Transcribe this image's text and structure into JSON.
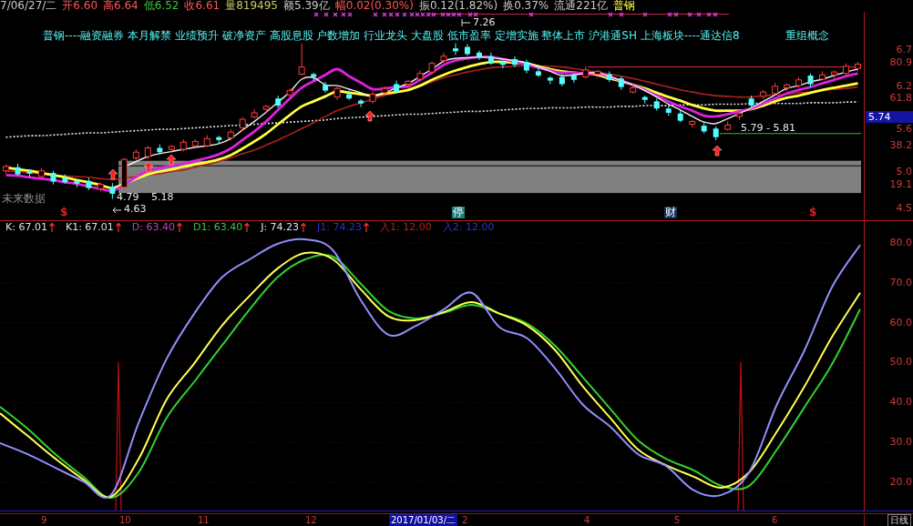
{
  "quote_bar": {
    "items": [
      {
        "text": "7/06/27/二",
        "color": "#c8c8c8"
      },
      {
        "text": "开6.60",
        "color": "#ff5454"
      },
      {
        "text": "高6.64",
        "color": "#ff5454"
      },
      {
        "text": "低6.52",
        "color": "#3cc83c"
      },
      {
        "text": "收6.61",
        "color": "#ff5454"
      },
      {
        "text": "量819495",
        "color": "#c8c864"
      },
      {
        "text": "额5.39亿",
        "color": "#c8c8c8"
      },
      {
        "text": "幅0.02(0.30%)",
        "color": "#ff5454"
      },
      {
        "text": "振0.12(1.82%)",
        "color": "#c8c8c8"
      },
      {
        "text": "换0.37%",
        "color": "#c8c8c8"
      },
      {
        "text": "流通221亿",
        "color": "#c8c8c8"
      },
      {
        "text": "普钢",
        "color": "#ffff40"
      }
    ]
  },
  "price_panel": {
    "concepts": "普钢----融资融券 本月解禁 业绩预升 破净资产 高股息股 户数增加 行业龙头 大盘股 低市盈率 定增实施 整体上市 沪港通SH 上海板块----通达信8",
    "concepts_tail": "重组概念",
    "future_label": "未来数据",
    "annotations": [
      "7.26",
      "5.79 - 5.81",
      "4.79",
      "5.18",
      "4.63"
    ],
    "markers": [
      {
        "text": "$",
        "kind": "plain",
        "color": "#e02020"
      },
      {
        "text": "停",
        "kind": "boxed",
        "color": "#1e7e7e"
      },
      {
        "text": "财",
        "kind": "boxed",
        "color": "#12305a"
      },
      {
        "text": "$",
        "kind": "plain",
        "color": "#e02020"
      }
    ],
    "level_labels": [
      "80.9",
      "61.8",
      "38.2",
      "19.1"
    ],
    "current_price": "5.74",
    "chart_data": {
      "type": "candlestick",
      "ylim": [
        4.33,
        7.24
      ],
      "yticks": [
        {
          "value": 6.7,
          "label": "6.7"
        },
        {
          "value": 6.2,
          "label": "6.2"
        },
        {
          "value": 5.6,
          "label": "5.6"
        },
        {
          "value": 5.0,
          "label": "5.0"
        },
        {
          "value": 4.5,
          "label": "4.5"
        }
      ],
      "categories": [
        null,
        null,
        null,
        null,
        null,
        null,
        null,
        null,
        null,
        null,
        null,
        null,
        null,
        null,
        null,
        null,
        null,
        null,
        null,
        null,
        null,
        null,
        null,
        null,
        null,
        null,
        null,
        null,
        null,
        null,
        null,
        null,
        null,
        null,
        null,
        null,
        null,
        null,
        null,
        null,
        null,
        null,
        null,
        null,
        null,
        null,
        null,
        null,
        null,
        null,
        null,
        null,
        null,
        null,
        null,
        null,
        null,
        null,
        null,
        null,
        null,
        null,
        null,
        null,
        null,
        null,
        null,
        null,
        null,
        null,
        null,
        null,
        null
      ],
      "ohlc": [
        [
          5.02,
          5.11,
          4.98,
          5.08
        ],
        [
          5.07,
          5.12,
          4.95,
          4.97
        ],
        [
          5.02,
          5.04,
          4.93,
          4.98
        ],
        [
          4.94,
          5.06,
          4.91,
          5.02
        ],
        [
          4.99,
          5.02,
          4.83,
          4.87
        ],
        [
          4.92,
          4.97,
          4.84,
          4.86
        ],
        [
          4.88,
          4.9,
          4.79,
          4.84
        ],
        [
          4.88,
          4.92,
          4.75,
          4.78
        ],
        [
          4.77,
          4.86,
          4.73,
          4.83
        ],
        [
          4.8,
          4.85,
          4.63,
          4.7
        ],
        [
          4.79,
          5.2,
          4.78,
          5.18
        ],
        [
          5.2,
          5.32,
          5.17,
          5.28
        ],
        [
          5.22,
          5.37,
          5.18,
          5.34
        ],
        [
          5.34,
          5.39,
          5.26,
          5.28
        ],
        [
          5.32,
          5.38,
          5.27,
          5.36
        ],
        [
          5.32,
          5.46,
          5.29,
          5.42
        ],
        [
          5.37,
          5.46,
          5.33,
          5.43
        ],
        [
          5.37,
          5.52,
          5.35,
          5.47
        ],
        [
          5.49,
          5.51,
          5.4,
          5.45
        ],
        [
          5.48,
          5.6,
          5.45,
          5.56
        ],
        [
          5.62,
          5.77,
          5.58,
          5.74
        ],
        [
          5.77,
          5.88,
          5.75,
          5.83
        ],
        [
          5.88,
          5.94,
          5.83,
          5.92
        ],
        [
          6.03,
          6.07,
          5.9,
          5.93
        ],
        [
          6.08,
          6.17,
          6.04,
          6.14
        ],
        [
          6.37,
          6.8,
          6.35,
          6.47
        ],
        [
          6.37,
          6.39,
          6.28,
          6.33
        ],
        [
          6.22,
          6.26,
          6.11,
          6.14
        ],
        [
          6.05,
          6.2,
          6.01,
          6.17
        ],
        [
          6.09,
          6.14,
          6.01,
          6.03
        ],
        [
          6.0,
          6.02,
          5.91,
          5.96
        ],
        [
          5.99,
          6.13,
          5.96,
          6.09
        ],
        [
          6.11,
          6.2,
          6.07,
          6.17
        ],
        [
          6.23,
          6.28,
          6.11,
          6.13
        ],
        [
          6.23,
          6.29,
          6.18,
          6.27
        ],
        [
          6.3,
          6.42,
          6.27,
          6.38
        ],
        [
          6.4,
          6.55,
          6.36,
          6.52
        ],
        [
          6.56,
          6.67,
          6.54,
          6.62
        ],
        [
          6.73,
          6.8,
          6.64,
          6.69
        ],
        [
          6.75,
          6.79,
          6.62,
          6.65
        ],
        [
          6.67,
          6.7,
          6.57,
          6.61
        ],
        [
          6.62,
          6.67,
          6.5,
          6.52
        ],
        [
          6.54,
          6.56,
          6.45,
          6.5
        ],
        [
          6.58,
          6.62,
          6.47,
          6.5
        ],
        [
          6.54,
          6.57,
          6.38,
          6.42
        ],
        [
          6.41,
          6.46,
          6.33,
          6.35
        ],
        [
          6.32,
          6.34,
          6.23,
          6.28
        ],
        [
          6.33,
          6.37,
          6.2,
          6.23
        ],
        [
          6.35,
          6.38,
          6.25,
          6.29
        ],
        [
          6.33,
          6.48,
          6.31,
          6.43
        ],
        [
          6.37,
          6.43,
          6.32,
          6.41
        ],
        [
          6.37,
          6.41,
          6.26,
          6.29
        ],
        [
          6.31,
          6.34,
          6.15,
          6.19
        ],
        [
          6.12,
          6.23,
          6.1,
          6.18
        ],
        [
          6.05,
          6.07,
          5.96,
          6.01
        ],
        [
          5.99,
          6.03,
          5.86,
          5.89
        ],
        [
          5.89,
          5.92,
          5.79,
          5.83
        ],
        [
          5.82,
          5.87,
          5.7,
          5.72
        ],
        [
          5.67,
          5.73,
          5.62,
          5.71
        ],
        [
          5.65,
          5.69,
          5.54,
          5.57
        ],
        [
          5.61,
          5.64,
          5.45,
          5.49
        ],
        [
          5.6,
          5.71,
          5.58,
          5.66
        ],
        [
          5.78,
          5.84,
          5.73,
          5.82
        ],
        [
          6.03,
          6.07,
          5.9,
          5.93
        ],
        [
          6.06,
          6.15,
          6.02,
          6.12
        ],
        [
          6.1,
          6.25,
          6.08,
          6.2
        ],
        [
          6.18,
          6.24,
          6.13,
          6.22
        ],
        [
          6.21,
          6.33,
          6.18,
          6.29
        ],
        [
          6.35,
          6.38,
          6.19,
          6.23
        ],
        [
          6.3,
          6.41,
          6.28,
          6.36
        ],
        [
          6.36,
          6.42,
          6.31,
          6.4
        ],
        [
          6.38,
          6.52,
          6.35,
          6.48
        ],
        [
          6.45,
          6.54,
          6.41,
          6.51
        ]
      ],
      "series": [
        {
          "type": "line",
          "color": "#e8e8e8",
          "line_style": "dashed",
          "values": [
            5.49,
            5.5,
            5.51,
            5.51,
            5.52,
            5.53,
            5.54,
            5.55,
            5.55,
            5.56,
            5.57,
            5.58,
            5.59,
            5.6,
            5.6,
            5.61,
            5.62,
            5.63,
            5.64,
            5.65,
            5.66,
            5.67,
            5.68,
            5.69,
            5.7,
            5.71,
            5.72,
            5.73,
            5.75,
            5.76,
            5.77,
            5.78,
            5.79,
            5.8,
            5.81,
            5.81,
            5.82,
            5.83,
            5.84,
            5.85,
            5.85,
            5.86,
            5.87,
            5.88,
            5.89,
            5.89,
            5.9,
            5.9,
            5.9,
            5.91,
            5.91,
            5.91,
            5.92,
            5.92,
            5.93,
            5.93,
            5.93,
            5.94,
            5.94,
            5.94,
            5.95,
            5.95,
            5.95,
            5.96,
            5.96,
            5.96,
            5.96,
            5.96,
            5.97,
            5.97,
            5.97,
            5.98,
            5.98
          ]
        },
        {
          "type": "line",
          "color": "#b02020",
          "values": [
            5.02,
            5.01,
            4.99,
            4.98,
            4.96,
            4.95,
            4.94,
            4.93,
            4.91,
            4.9,
            4.92,
            4.94,
            4.96,
            4.98,
            5.01,
            5.03,
            5.07,
            5.11,
            5.15,
            5.2,
            5.26,
            5.31,
            5.38,
            5.45,
            5.53,
            5.61,
            5.69,
            5.78,
            5.86,
            5.92,
            5.97,
            6.02,
            6.07,
            6.11,
            6.15,
            6.2,
            6.26,
            6.32,
            6.36,
            6.4,
            6.43,
            6.46,
            6.47,
            6.48,
            6.49,
            6.48,
            6.48,
            6.47,
            6.45,
            6.42,
            6.4,
            6.37,
            6.34,
            6.31,
            6.27,
            6.23,
            6.19,
            6.15,
            6.12,
            6.09,
            6.07,
            6.06,
            6.05,
            6.05,
            6.07,
            6.08,
            6.09,
            6.11,
            6.12,
            6.14,
            6.16,
            6.17,
            6.19
          ]
        },
        {
          "type": "line",
          "color": "#ffff40",
          "values": [
            5.07,
            5.04,
            5.02,
            4.99,
            4.96,
            4.93,
            4.89,
            4.86,
            4.82,
            4.78,
            4.84,
            4.91,
            4.97,
            5.01,
            5.04,
            5.08,
            5.11,
            5.14,
            5.18,
            5.24,
            5.33,
            5.43,
            5.54,
            5.67,
            5.8,
            5.92,
            5.99,
            6.06,
            6.13,
            6.11,
            6.09,
            6.07,
            6.1,
            6.12,
            6.15,
            6.21,
            6.29,
            6.36,
            6.42,
            6.47,
            6.51,
            6.54,
            6.54,
            6.53,
            6.52,
            6.48,
            6.44,
            6.41,
            6.39,
            6.38,
            6.36,
            6.31,
            6.27,
            6.22,
            6.17,
            6.11,
            6.05,
            6.0,
            5.94,
            5.89,
            5.86,
            5.86,
            5.86,
            5.88,
            5.93,
            5.99,
            6.04,
            6.07,
            6.11,
            6.15,
            6.18,
            6.21,
            6.24
          ]
        },
        {
          "type": "line",
          "color": "#e020e0",
          "values": [
            4.96,
            4.95,
            4.93,
            4.91,
            4.89,
            4.86,
            4.84,
            4.8,
            4.77,
            4.74,
            4.83,
            4.93,
            5.02,
            5.06,
            5.09,
            5.12,
            5.16,
            5.2,
            5.25,
            5.33,
            5.45,
            5.57,
            5.71,
            5.87,
            6.03,
            6.18,
            6.27,
            6.36,
            6.44,
            6.34,
            6.25,
            6.16,
            6.17,
            6.19,
            6.2,
            6.29,
            6.39,
            6.5,
            6.56,
            6.59,
            6.61,
            6.61,
            6.58,
            6.54,
            6.5,
            6.46,
            6.42,
            6.39,
            6.39,
            6.38,
            6.38,
            6.33,
            6.28,
            6.22,
            6.15,
            6.07,
            5.99,
            5.92,
            5.86,
            5.79,
            5.78,
            5.81,
            5.85,
            5.89,
            5.96,
            6.03,
            6.1,
            6.15,
            6.19,
            6.24,
            6.29,
            6.34,
            6.38
          ]
        },
        {
          "type": "line",
          "color": "#f0f0f0",
          "values": [
            null,
            null,
            null,
            null,
            null,
            null,
            null,
            null,
            null,
            null,
            5.07,
            5.15,
            5.22,
            5.26,
            5.29,
            5.32,
            5.35,
            5.37,
            5.4,
            5.47,
            5.59,
            5.71,
            5.84,
            5.98,
            6.12,
            6.3,
            6.32,
            6.22,
            6.21,
            6.16,
            6.11,
            6.06,
            6.11,
            6.18,
            6.24,
            6.34,
            6.44,
            6.55,
            6.59,
            6.6,
            6.61,
            6.6,
            6.58,
            6.56,
            6.53,
            6.47,
            6.41,
            6.35,
            6.36,
            6.38,
            6.39,
            6.34,
            6.28,
            6.22,
            6.14,
            6.05,
            5.95,
            5.87,
            5.78,
            5.7,
            5.68,
            5.75,
            5.82,
            5.9,
            5.99,
            6.08,
            6.17,
            6.21,
            6.26,
            6.3,
            6.35,
            6.4,
            6.44
          ]
        }
      ],
      "bands": [
        {
          "axis": "y",
          "from": 4.71,
          "to": 5.16,
          "color": "#808080"
        }
      ],
      "ref_lines": [
        {
          "axis": "y",
          "value": 5.09,
          "color": "#000000"
        },
        {
          "axis": "y",
          "value": 6.47,
          "color": "#e03040"
        },
        {
          "axis": "y",
          "value": 5.54,
          "color": "#30c030"
        }
      ]
    }
  },
  "kdj_panel": {
    "legend": [
      {
        "text": "K: 67.01",
        "color": "#e0e0e0",
        "arrow": true
      },
      {
        "text": "K1: 67.01",
        "color": "#e0e0e0",
        "arrow": true
      },
      {
        "text": "D: 63.40",
        "color": "#c040c0",
        "arrow": true
      },
      {
        "text": "D1: 63.40",
        "color": "#40c040",
        "arrow": true
      },
      {
        "text": "J: 74.23",
        "color": "#e0e0e0",
        "arrow": true
      },
      {
        "text": "J1: 74.23",
        "color": "#3030d0",
        "arrow": true
      },
      {
        "text": "入1: 12.00",
        "color": "#b02020",
        "arrow": false
      },
      {
        "text": "入2: 12.00",
        "color": "#3030d0",
        "arrow": false
      }
    ],
    "chart_data": {
      "type": "line",
      "grid": true,
      "ylim": [
        12.9,
        85.5
      ],
      "yticks": [
        {
          "value": 80,
          "label": "80.0"
        },
        {
          "value": 70,
          "label": "70.0"
        },
        {
          "value": 60,
          "label": "60.0"
        },
        {
          "value": 50,
          "label": "50.0"
        },
        {
          "value": 40,
          "label": "40.0"
        },
        {
          "value": 30,
          "label": "30.0"
        },
        {
          "value": 20,
          "label": "20.0"
        }
      ],
      "series": [
        {
          "color": "#30d030",
          "values": [
            38.9,
            33.4,
            27.0,
            21.4,
            16.1,
            22.5,
            36.1,
            45.2,
            54.3,
            63.4,
            71.4,
            75.9,
            76.6,
            69.8,
            63.0,
            61.1,
            62.5,
            64.5,
            62.3,
            59.8,
            54.3,
            46.4,
            38.4,
            30.5,
            25.9,
            23.0,
            19.1,
            19.1,
            28.2,
            38.9,
            49.8,
            63.4
          ]
        },
        {
          "color": "#ffff50",
          "values": [
            37.3,
            31.6,
            25.9,
            20.7,
            16.4,
            25.9,
            40.7,
            49.8,
            59.3,
            66.8,
            73.6,
            77.5,
            75.9,
            68.4,
            61.6,
            60.7,
            62.7,
            65.2,
            62.3,
            59.3,
            53.2,
            44.1,
            36.1,
            28.2,
            24.3,
            21.4,
            18.6,
            22.5,
            32.7,
            44.1,
            56.6,
            67.5
          ]
        },
        {
          "color": "#9090ff",
          "values": [
            29.8,
            27.0,
            23.6,
            20.2,
            16.8,
            35.0,
            50.9,
            62.3,
            71.4,
            75.9,
            79.8,
            80.9,
            78.2,
            65.7,
            57.0,
            59.3,
            63.4,
            67.5,
            58.9,
            56.1,
            48.6,
            39.5,
            33.9,
            27.0,
            24.1,
            18.0,
            16.8,
            22.5,
            39.5,
            53.2,
            69.1,
            79.5
          ]
        }
      ]
    }
  },
  "date_axis": {
    "labels": [
      {
        "text": "9",
        "kind": "tick"
      },
      {
        "text": "10",
        "kind": "tick"
      },
      {
        "text": "11",
        "kind": "tick"
      },
      {
        "text": "12",
        "kind": "tick"
      },
      {
        "text": "2017/01/03/二",
        "kind": "cursor"
      },
      {
        "text": "2",
        "kind": "tick"
      },
      {
        "text": "4",
        "kind": "tick"
      },
      {
        "text": "5",
        "kind": "tick"
      },
      {
        "text": "6",
        "kind": "tick"
      }
    ],
    "period": "日线"
  }
}
